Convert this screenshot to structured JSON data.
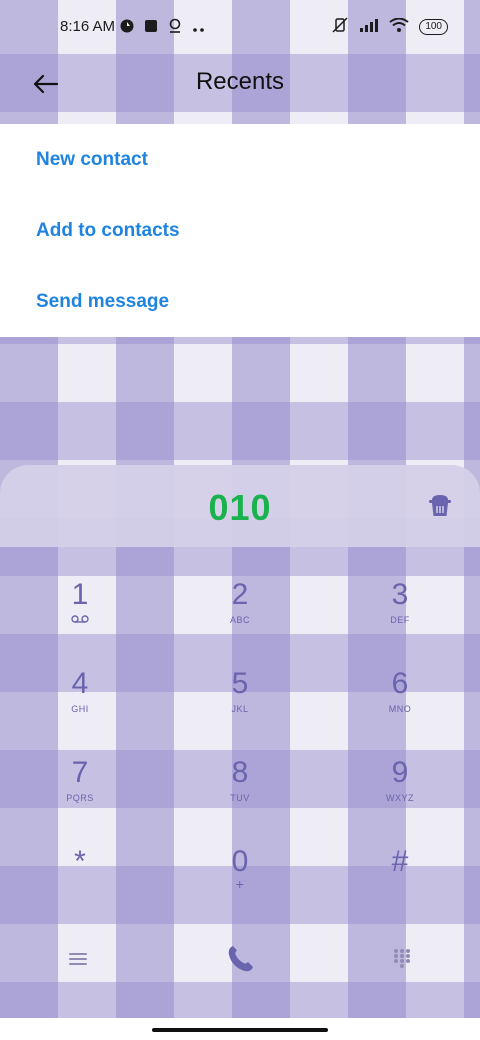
{
  "status_bar": {
    "time": "8:16 AM",
    "battery": "100"
  },
  "header": {
    "title": "Recents"
  },
  "menu": {
    "items": [
      {
        "label": "New contact"
      },
      {
        "label": "Add to contacts"
      },
      {
        "label": "Send message"
      }
    ]
  },
  "dialer": {
    "number": "010",
    "number_color": "#19b24c",
    "key_color": "#6a63ad",
    "keys": [
      {
        "digit": "1",
        "letters": ""
      },
      {
        "digit": "2",
        "letters": "ABC"
      },
      {
        "digit": "3",
        "letters": "DEF"
      },
      {
        "digit": "4",
        "letters": "GHI"
      },
      {
        "digit": "5",
        "letters": "JKL"
      },
      {
        "digit": "6",
        "letters": "MNO"
      },
      {
        "digit": "7",
        "letters": "PQRS"
      },
      {
        "digit": "8",
        "letters": "TUV"
      },
      {
        "digit": "9",
        "letters": "WXYZ"
      },
      {
        "digit": "*",
        "letters": ""
      },
      {
        "digit": "0",
        "letters": "+"
      },
      {
        "digit": "#",
        "letters": ""
      }
    ]
  },
  "accent_color": "#1f84df"
}
